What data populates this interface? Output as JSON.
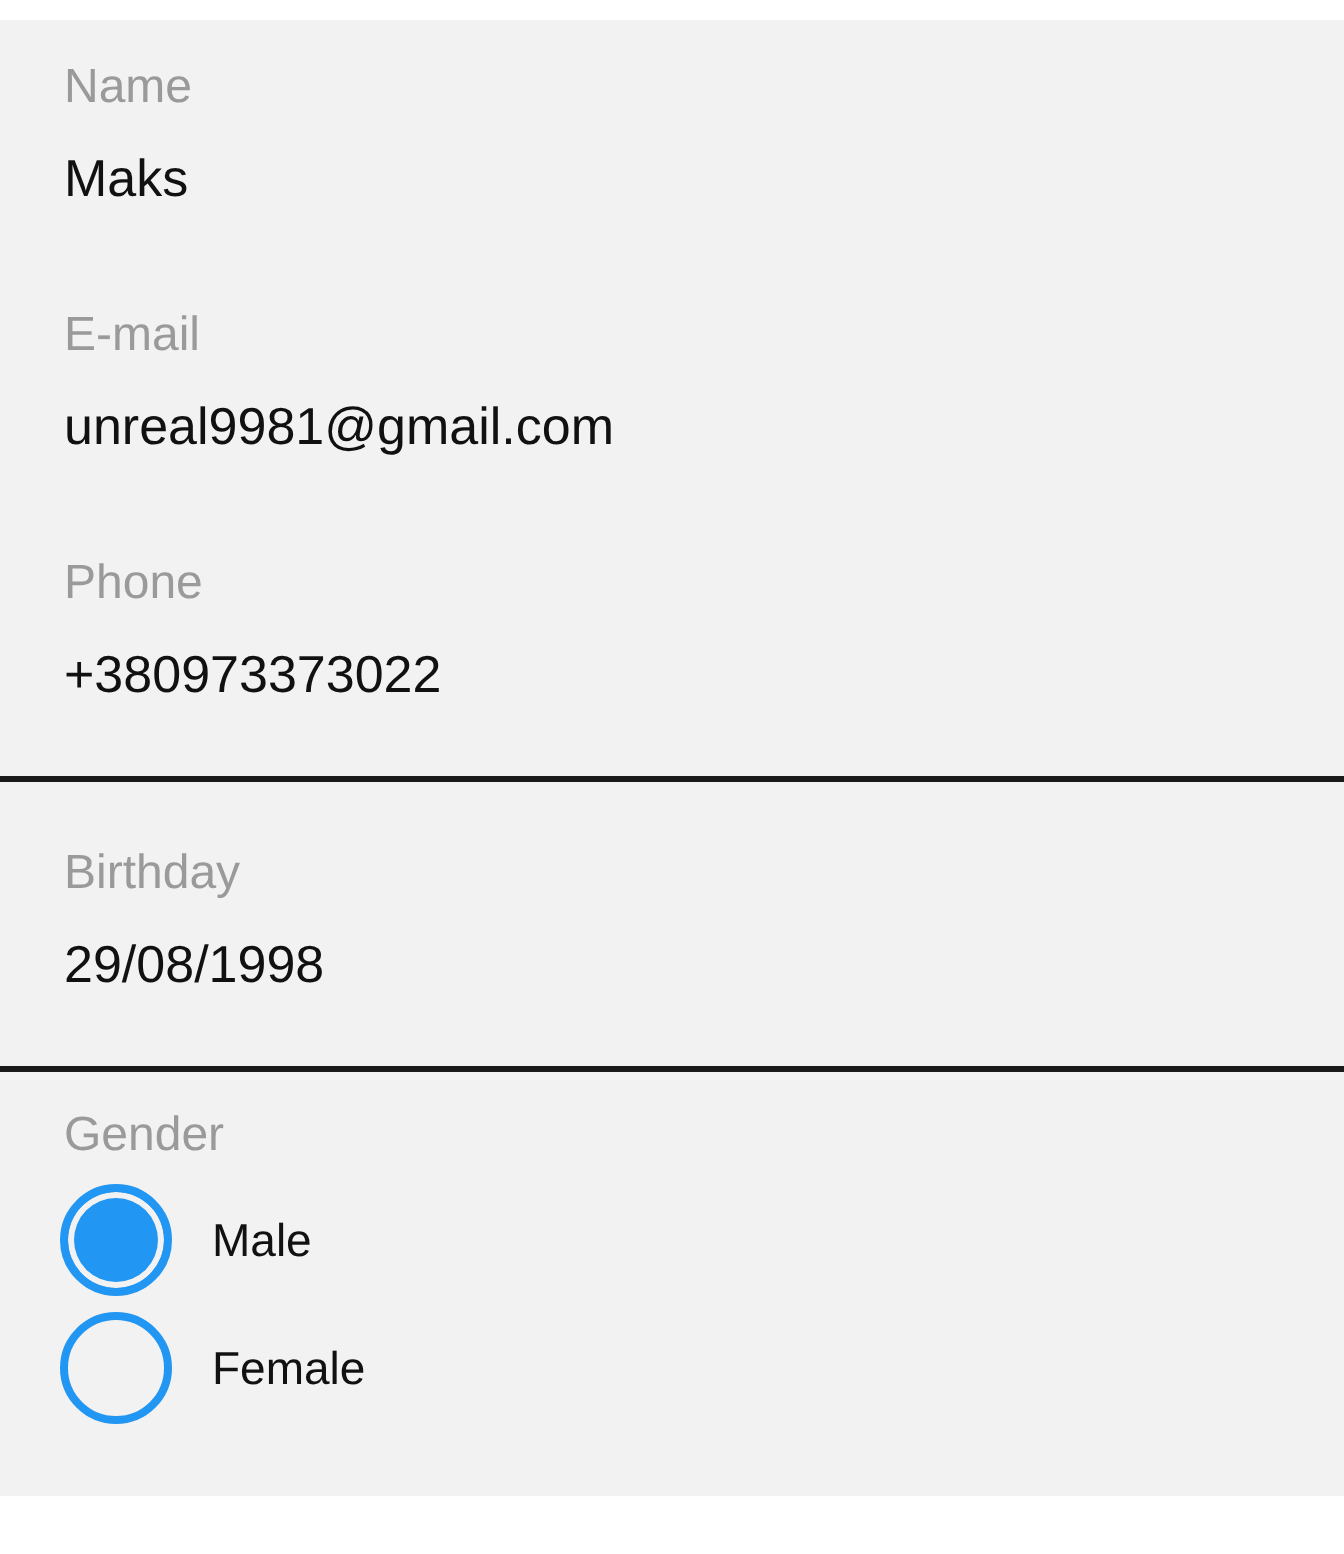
{
  "fields": [
    {
      "label": "Name",
      "value": "Maks",
      "underlined": false
    },
    {
      "label": "E-mail",
      "value": "unreal9981@gmail.com",
      "underlined": false
    },
    {
      "label": "Phone",
      "value": "+380973373022",
      "underlined": true
    },
    {
      "label": "Birthday",
      "value": "29/08/1998",
      "underlined": true
    }
  ],
  "gender": {
    "label": "Gender",
    "options": [
      {
        "label": "Male",
        "selected": true
      },
      {
        "label": "Female",
        "selected": false
      }
    ]
  }
}
